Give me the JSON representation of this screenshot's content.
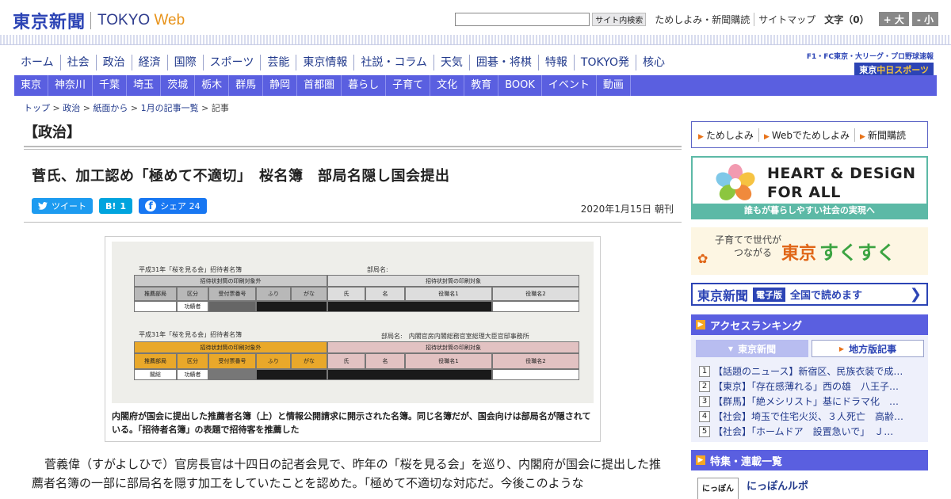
{
  "header": {
    "logo_jp": "東京新聞",
    "logo_en_a": "TOKYO",
    "logo_en_b": "Web",
    "search_btn": "サイト内検索",
    "links": [
      "ためしよみ・新聞購読",
      "サイトマップ"
    ],
    "font_size_label": "文字（0）",
    "font_plus": "+ 大",
    "font_minus": "- 小"
  },
  "global_nav": [
    "ホーム",
    "社会",
    "政治",
    "経済",
    "国際",
    "スポーツ",
    "芸能",
    "東京情報",
    "社説・コラム",
    "天気",
    "囲碁・将棋",
    "特報",
    "TOKYO発",
    "核心"
  ],
  "chunichi": {
    "top": "F1・FC東京・大リーグ・プロ野球速報",
    "logo_a": "東京",
    "logo_b": "中日スポーツ"
  },
  "region_nav": [
    "東京",
    "神奈川",
    "千葉",
    "埼玉",
    "茨城",
    "栃木",
    "群馬",
    "静岡",
    "首都圏",
    "暮らし",
    "子育て",
    "文化",
    "教育",
    "BOOK",
    "イベント",
    "動画"
  ],
  "breadcrumb": [
    "トップ",
    "政治",
    "紙面から",
    "1月の記事一覧",
    "記事"
  ],
  "section_title": "【政治】",
  "article": {
    "headline": "菅氏、加工認め「極めて不適切」　桜名簿　部局名隠し国会提出",
    "share": {
      "tweet": "ツイート",
      "hatena_icon": "B!",
      "hatena_count": "1",
      "fb_icon": "f",
      "fb": "シェア",
      "fb_count": "24"
    },
    "date": "2020年1月15日 朝刊",
    "caption": "内閣府が国会に提出した推薦者名簿（上）と情報公開請求に開示された名簿。同じ名簿だが、国会向けは部局名が隠されている。「招待者名簿」の表題で招待客を推薦した",
    "body": "菅義偉（すがよしひで）官房長官は十四日の記者会見で、昨年の「桜を見る会」を巡り、内閣府が国会に提出した推薦者名簿の一部に部局名を隠す加工をしていたことを認めた。「極めて不適切な対応だ。今後このような"
  },
  "photo_doc": {
    "title1": "平成31年「桜を見る会」招待者名簿",
    "dept1": "部局名:",
    "title2": "平成31年「桜を見る会」招待者名簿",
    "dept2": "部局名:　内閣官房内閣総務官室総理大臣官邸事務所",
    "hdr_out": "招待状封筒の印刷対象外",
    "hdr_in": "招待状封筒の印刷対象",
    "cols": [
      "推薦部局",
      "区分",
      "受付票番号",
      "ふり",
      "がな",
      "氏",
      "名",
      "役職名1",
      "役職名2"
    ],
    "row1": "功績者",
    "row2a": "閣総",
    "row2b": "功績者"
  },
  "sidebar": {
    "promo_links": [
      "ためしよみ",
      "Webでためしよみ",
      "新聞購読"
    ],
    "hd_line1": "HEART & DESiGN",
    "hd_line2": "FOR ALL",
    "hd_sub": "誰もが暮らしやすい社会の実現へ",
    "suku_small1": "子育てで世代が",
    "suku_small2": "つながる",
    "suku_big1": "東京",
    "suku_big2": "すくすく",
    "ebook_logo": "東京新聞",
    "ebook_tag": "電子版",
    "ebook_text": "全国で読めます",
    "ranking_title": "アクセスランキング",
    "rank_tab1": "東京新聞",
    "rank_tab2": "地方版記事",
    "rankings": [
      {
        "n": "1",
        "text": "【話題のニュース】新宿区、民族衣装で成…"
      },
      {
        "n": "2",
        "text": "【東京】「存在感薄れる」西の雄　八王子…"
      },
      {
        "n": "3",
        "text": "【群馬】「絶メシリスト」基にドラマ化　…"
      },
      {
        "n": "4",
        "text": "【社会】埼玉で住宅火災、３人死亡　高齢…"
      },
      {
        "n": "5",
        "text": "【社会】「ホームドア　設置急いで」　Ｊ…"
      }
    ],
    "feature_title": "特集・連載一覧",
    "feature_thumb": "にっぽん",
    "feature_item": "にっぽんルポ"
  },
  "colors": {
    "brand_blue": "#2c44b5",
    "nav_blue": "#5a5fe0",
    "accent_orange": "#e8931a"
  }
}
